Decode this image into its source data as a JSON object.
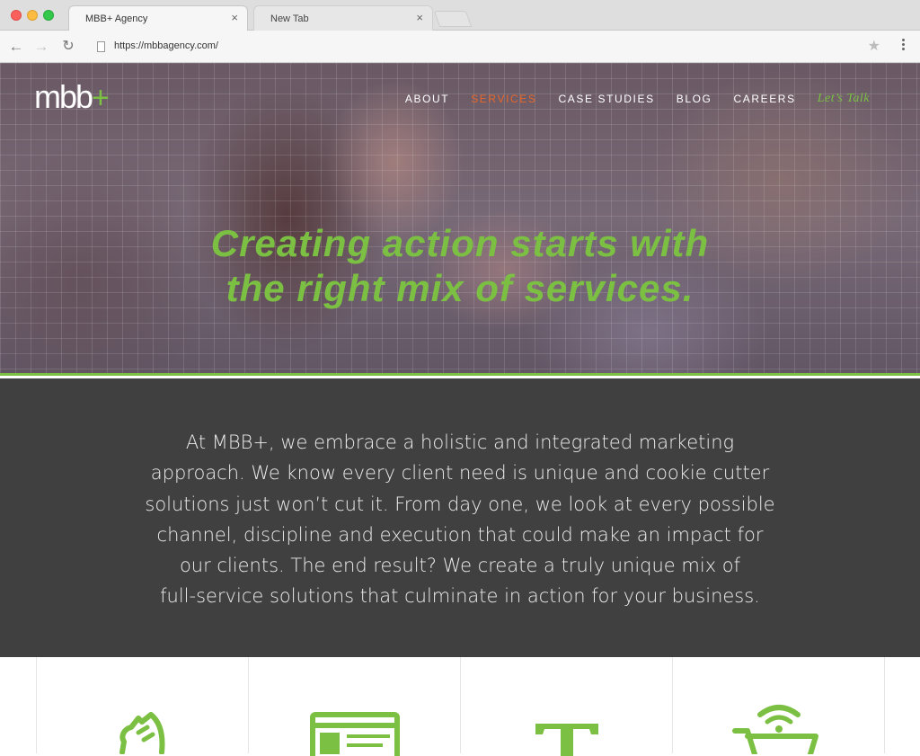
{
  "browser": {
    "tabs": [
      {
        "title": "MBB+ Agency",
        "active": true
      },
      {
        "title": "New Tab",
        "active": false
      }
    ],
    "url": "https://mbbagency.com/",
    "icons": {
      "back": "arrow-left",
      "forward": "arrow-right",
      "reload": "reload",
      "bookmark": "star",
      "menu": "vertical-dots",
      "close": "x"
    }
  },
  "site": {
    "logo": {
      "text": "mbb",
      "plus": "+"
    },
    "nav": {
      "items": [
        {
          "label": "ABOUT"
        },
        {
          "label": "SERVICES",
          "current": true
        },
        {
          "label": "CASE STUDIES"
        },
        {
          "label": "BLOG"
        },
        {
          "label": "CAREERS"
        }
      ],
      "cta": "Let’s Talk"
    },
    "hero": {
      "headline_lines": [
        "Creating action starts with",
        "the right mix of services."
      ]
    },
    "intro": {
      "lines": [
        "At MBB+, we embrace a holistic and integrated marketing",
        "approach. We know every client need is unique and cookie cutter",
        "solutions just won’t cut it. From day one, we look at every possible",
        "channel, discipline and execution that could make an impact for",
        "our clients. The end result? We create a truly unique mix of",
        "full-service solutions that culminate in action for your business."
      ]
    },
    "services": {
      "icons": [
        "chess-knight-icon",
        "browser-window-icon",
        "typography-t-icon",
        "shopping-cart-wifi-icon"
      ]
    }
  },
  "colors": {
    "accent_green": "#7bc043",
    "nav_active_orange": "#e8672a",
    "intro_bg": "#404040",
    "intro_text": "#ececec"
  }
}
